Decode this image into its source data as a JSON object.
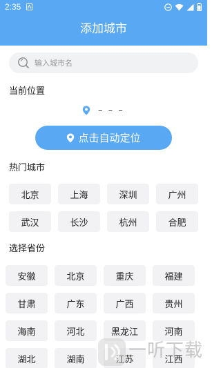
{
  "status_bar": {
    "time": "2:35"
  },
  "header": {
    "title": "添加城市"
  },
  "search": {
    "placeholder": "输入城市名"
  },
  "current_location": {
    "heading": "当前位置",
    "city": "– – –",
    "auto_locate_label": "点击自动定位"
  },
  "hot_cities": {
    "heading": "热门城市",
    "items": [
      "北京",
      "上海",
      "深圳",
      "广州",
      "武汉",
      "长沙",
      "杭州",
      "合肥"
    ]
  },
  "provinces": {
    "heading": "选择省份",
    "items": [
      "安徽",
      "北京",
      "重庆",
      "福建",
      "甘肃",
      "广东",
      "广西",
      "贵州",
      "海南",
      "河北",
      "黑龙江",
      "河南",
      "湖北",
      "湖南",
      "江苏",
      "江西"
    ]
  },
  "watermark": {
    "text": "一听下载"
  },
  "colors": {
    "accent": "#58a8f3",
    "chip_bg": "#f2f2f4",
    "search_bg": "#f1f2f4"
  }
}
